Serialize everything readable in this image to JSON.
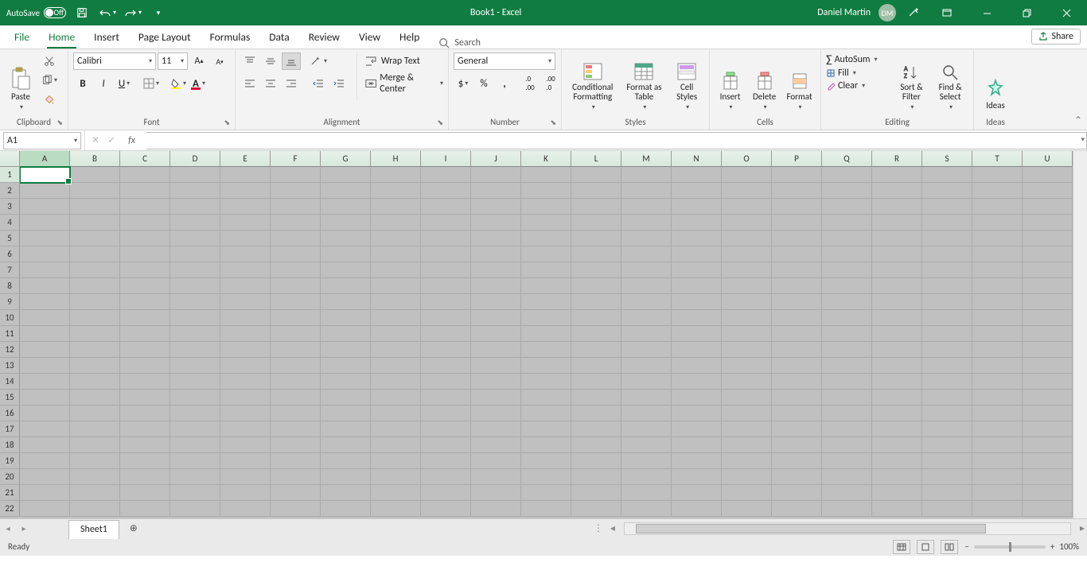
{
  "titlebar": {
    "autosave": "AutoSave",
    "autosave_state": "Off",
    "title": "Book1  -  Excel",
    "user": "Daniel Martin",
    "initials": "DM"
  },
  "tabs": {
    "file": "File",
    "home": "Home",
    "insert": "Insert",
    "pagelayout": "Page Layout",
    "formulas": "Formulas",
    "data": "Data",
    "review": "Review",
    "view": "View",
    "help": "Help",
    "search": "Search",
    "share": "Share"
  },
  "ribbon": {
    "clipboard": {
      "label": "Clipboard",
      "paste": "Paste"
    },
    "font": {
      "label": "Font",
      "name": "Calibri",
      "size": "11"
    },
    "alignment": {
      "label": "Alignment",
      "wrap": "Wrap Text",
      "merge": "Merge & Center"
    },
    "number": {
      "label": "Number",
      "format": "General"
    },
    "styles": {
      "label": "Styles",
      "cond": "Conditional Formatting",
      "fmt": "Format as Table",
      "cell": "Cell Styles"
    },
    "cells": {
      "label": "Cells",
      "insert": "Insert",
      "delete": "Delete",
      "format": "Format"
    },
    "editing": {
      "label": "Editing",
      "autosum": "AutoSum",
      "fill": "Fill",
      "clear": "Clear",
      "sort": "Sort & Filter",
      "find": "Find & Select"
    },
    "ideas": {
      "label": "Ideas",
      "btn": "Ideas"
    }
  },
  "namebox": "A1",
  "columns": [
    "A",
    "B",
    "C",
    "D",
    "E",
    "F",
    "G",
    "H",
    "I",
    "J",
    "K",
    "L",
    "M",
    "N",
    "O",
    "P",
    "Q",
    "R",
    "S",
    "T",
    "U"
  ],
  "rows": [
    "1",
    "2",
    "3",
    "4",
    "5",
    "6",
    "7",
    "8",
    "9",
    "10",
    "11",
    "12",
    "13",
    "14",
    "15",
    "16",
    "17",
    "18",
    "19",
    "20",
    "21",
    "22"
  ],
  "sheet": "Sheet1",
  "status": "Ready",
  "zoom": "100%"
}
